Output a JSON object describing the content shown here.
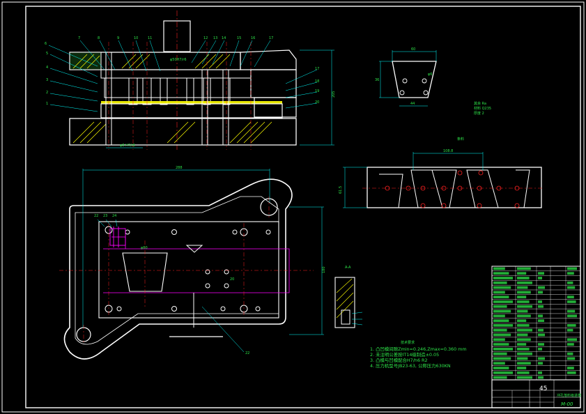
{
  "notes": {
    "heading": "技术要求",
    "lines": [
      "1. 凸凹模间隙Zmin=0.246,Zmax=0.360 mm",
      "2. 未注明公差按IT14级制造±0.05",
      "3. 凸模与凹模配合H7/h6 R2",
      "4. 压力机型号JB23-63, 公称压力630KN"
    ]
  },
  "title_block": {
    "scale": "45",
    "drawing_no": "M-00",
    "name": "冲孔落料级进模"
  },
  "section_label": "A-A",
  "colors": {
    "background": "#000000",
    "outline": "#ffffff",
    "dimension": "#00ffff",
    "center_line": "#ff2020",
    "hatch": "#ffff00",
    "strip": "#ff00ff",
    "text": "#2ee64a"
  }
}
